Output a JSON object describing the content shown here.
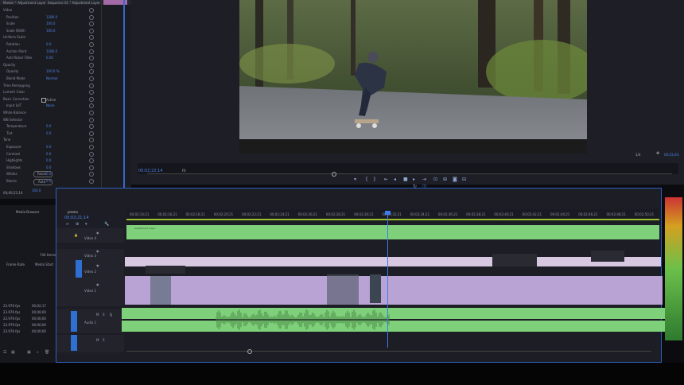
{
  "effect_controls": {
    "rows": [
      {
        "label": "Master * Adjustment Layer",
        "value": "Sequence 01 * Adjustment Layer"
      },
      {
        "label": "Video",
        "value": ""
      },
      {
        "label": "Position",
        "value": "1280.0"
      },
      {
        "label": "Scale",
        "value": "100.0"
      },
      {
        "label": "Scale Width",
        "value": "100.0"
      },
      {
        "label": "Uniform Scale",
        "value": ""
      },
      {
        "label": "Rotation",
        "value": "0.0"
      },
      {
        "label": "Anchor Point",
        "value": "1280.0"
      },
      {
        "label": "Anti-flicker Filter",
        "value": "0.00"
      },
      {
        "label": "Opacity",
        "value": ""
      },
      {
        "label": "Opacity",
        "value": "100.0 %"
      },
      {
        "label": "Blend Mode",
        "value": "Normal"
      },
      {
        "label": "Time Remapping",
        "value": ""
      },
      {
        "label": "Lumetri Color",
        "value": ""
      },
      {
        "label": "Basic Correction",
        "value": ""
      },
      {
        "label": "Input LUT",
        "value": "None"
      },
      {
        "label": "White Balance",
        "value": ""
      },
      {
        "label": "WB Selector",
        "value": ""
      },
      {
        "label": "Temperature",
        "value": "0.0"
      },
      {
        "label": "Tint",
        "value": "0.0"
      },
      {
        "label": "Tone",
        "value": ""
      },
      {
        "label": "Exposure",
        "value": "0.0"
      },
      {
        "label": "Contrast",
        "value": "0.0"
      },
      {
        "label": "Highlights",
        "value": "0.0"
      },
      {
        "label": "Shadows",
        "value": "0.0"
      },
      {
        "label": "Whites",
        "value": "0.0"
      },
      {
        "label": "Blacks",
        "value": "0.0"
      }
    ],
    "active_label": "Active",
    "reset_label": "Reset",
    "auto_label": "Auto",
    "saturation": "100.0",
    "bottom_time": "00;00;22;14"
  },
  "program_monitor": {
    "timecode": "00;02;22;14",
    "fit": "Fit",
    "quality": "1/4",
    "duration": "00;03;26;"
  },
  "project": {
    "tabs": [
      "Media Browser"
    ],
    "count": "744 Items",
    "col_frame": "Frame Rate",
    "col_media": "Media Start",
    "rows": [
      {
        "fps": "23.976 fps",
        "start": "00;02;17"
      },
      {
        "fps": "23.976 fps",
        "start": "00;00;00"
      },
      {
        "fps": "23.976 fps",
        "start": "00;00;00"
      },
      {
        "fps": "23.976 fps",
        "start": "00;00;00"
      },
      {
        "fps": "23.976 fps",
        "start": "00;00;00"
      }
    ]
  },
  "timeline": {
    "tab": "promo",
    "timecode": "00;02;21;14",
    "ruler": [
      "00;02;14;21",
      "00;02;16;21",
      "00;02;18;21",
      "00;02;20;21",
      "00;02;22;21",
      "00;02;24;21",
      "00;02;26;21",
      "00;02;28;21",
      "00;02;30;21",
      "00;02;32;21",
      "00;02;34;21",
      "00;02;36;21",
      "00;02;38;21",
      "00;02;40;21",
      "00;02;42;21",
      "00;02;44;21",
      "00;02;46;21",
      "00;02;48;21",
      "00;02;50;21"
    ],
    "tracks": {
      "v4": "Video 4",
      "v3": "Video 3",
      "v2": "Video 2",
      "v1": "Video 1",
      "a1": "Audio 1"
    },
    "clip_label": "Adjustment Layer"
  }
}
